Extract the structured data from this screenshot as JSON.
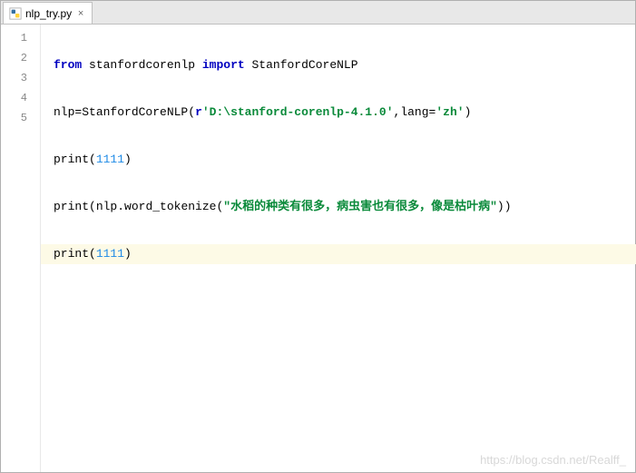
{
  "tab": {
    "filename": "nlp_try.py"
  },
  "gutter": {
    "lines": [
      "1",
      "2",
      "3",
      "4",
      "5"
    ]
  },
  "code": {
    "l1": {
      "kw1": "from",
      "mod": "stanfordcorenlp",
      "kw2": "import",
      "cls": "StanfordCoreNLP"
    },
    "l2": {
      "lhs": "nlp",
      "eq": "=",
      "ctor": "StanfordCoreNLP",
      "rpre": "r",
      "rawstr": "'D:\\stanford-corenlp-4.1.0'",
      "sep": ",",
      "kwarg": "lang",
      "eq2": "=",
      "val": "'zh'"
    },
    "l3": {
      "fn": "print",
      "arg": "1111"
    },
    "l4": {
      "fn": "print",
      "obj": "nlp",
      "dot": ".",
      "meth": "word_tokenize",
      "str": "\"水稻的种类有很多，病虫害也有很多，像是枯叶病\""
    },
    "l5": {
      "fn": "print",
      "arg": "1111"
    }
  },
  "watermark": "https://blog.csdn.net/Realff_"
}
